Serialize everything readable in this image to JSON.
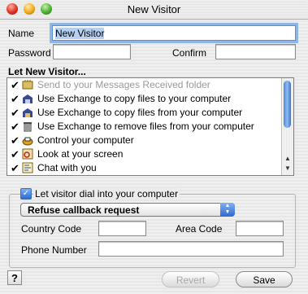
{
  "window": {
    "title": "New Visitor"
  },
  "form": {
    "name_label": "Name",
    "name_value": "New Visitor",
    "password_label": "Password",
    "confirm_label": "Confirm"
  },
  "permissions": {
    "heading": "Let New Visitor...",
    "items": [
      {
        "label": "Send to your Messages Received folder",
        "checked": true,
        "icon": "inbox-icon"
      },
      {
        "label": "Use Exchange to copy files to your computer",
        "checked": true,
        "icon": "exchange-to-icon"
      },
      {
        "label": "Use Exchange to copy files from your computer",
        "checked": true,
        "icon": "exchange-from-icon"
      },
      {
        "label": "Use Exchange to remove files from your computer",
        "checked": true,
        "icon": "trash-icon"
      },
      {
        "label": "Control your computer",
        "checked": true,
        "icon": "control-icon"
      },
      {
        "label": "Look at your screen",
        "checked": true,
        "icon": "observe-icon"
      },
      {
        "label": "Chat with you",
        "checked": true,
        "icon": "chat-icon"
      }
    ]
  },
  "dialin": {
    "checkbox_label": "Let visitor dial into your computer",
    "checked": true,
    "popup_value": "Refuse callback request",
    "country_code_label": "Country Code",
    "area_code_label": "Area Code",
    "phone_number_label": "Phone Number"
  },
  "buttons": {
    "help": "?",
    "revert": "Revert",
    "save": "Save"
  }
}
